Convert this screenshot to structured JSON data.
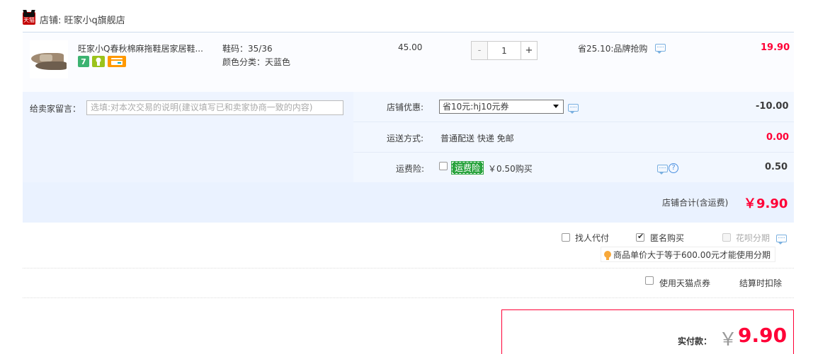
{
  "shop": {
    "logo_text": "天猫",
    "name": "店铺: 旺家小q旗舰店"
  },
  "item": {
    "title": "旺家小Q春秋棉麻拖鞋居家居鞋...",
    "badges": [
      "7",
      "medal",
      "card"
    ],
    "attr_size": "鞋码：35/36",
    "attr_color": "颜色分类：天蓝色",
    "unit_price": "45.00",
    "qty_minus": "-",
    "quantity": "1",
    "qty_plus": "+",
    "promo": "省25.10:品牌抢购",
    "subtotal": "19.90"
  },
  "options": {
    "message_label": "给卖家留言：",
    "message_placeholder": "选填:对本次交易的说明(建议填写已和卖家协商一致的内容)",
    "shop_discount_label": "店铺优惠:",
    "shop_discount_selected": "省10元:hj10元券",
    "shop_discount_value": "-10.00",
    "shipping_label": "运送方式:",
    "shipping_value": "普通配送 快递 免邮",
    "shipping_fee": "0.00",
    "insurance_label": "运费险:",
    "insurance_tag": "运费险",
    "insurance_text": "￥0.50购买",
    "insurance_value": "0.50",
    "help_symbol": "?",
    "shop_total_label": "店铺合计(含运费)",
    "shop_total_value": "￥9.90"
  },
  "extras": {
    "proxy_pay": "找人代付",
    "anonymous": "匿名购买",
    "installment": "花呗分期",
    "installment_tip": "商品单价大于等于600.00元才能使用分期",
    "use_points": "使用天猫点券",
    "points_note": "结算时扣除"
  },
  "payment": {
    "label": "实付款：",
    "currency": "￥",
    "amount": "9.90"
  },
  "colors": {
    "accent": "#ff0036",
    "insurance_green": "#29a33e",
    "panel_blue": "#eef4ff"
  }
}
